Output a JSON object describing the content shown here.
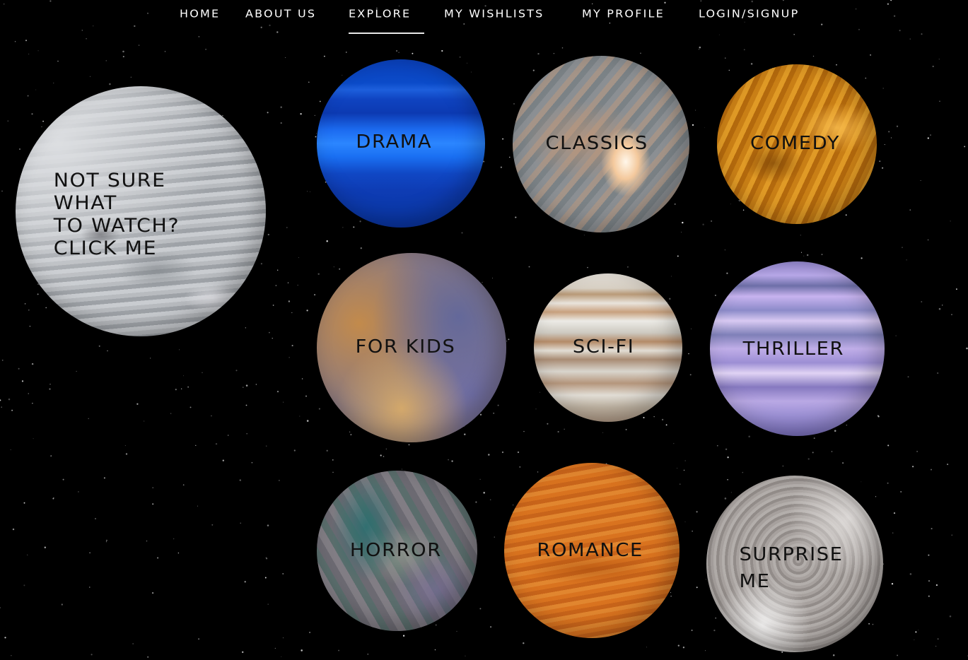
{
  "nav": {
    "items": [
      {
        "label": "HOME",
        "active": false
      },
      {
        "label": "ABOUT US",
        "active": false
      },
      {
        "label": "EXPLORE",
        "active": true
      },
      {
        "label": "MY WISHLISTS",
        "active": false
      },
      {
        "label": "MY PROFILE",
        "active": false
      },
      {
        "label": "LOGIN/SIGNUP",
        "active": false
      }
    ]
  },
  "feature": {
    "label": "NOT SURE\nWHAT\nTO WATCH?\nCLICK ME"
  },
  "genres": [
    {
      "label": "DRAMA"
    },
    {
      "label": "CLASSICS"
    },
    {
      "label": "COMEDY"
    },
    {
      "label": "FOR KIDS"
    },
    {
      "label": "SCI-FI"
    },
    {
      "label": "THRILLER"
    },
    {
      "label": "HORROR"
    },
    {
      "label": "ROMANCE"
    },
    {
      "label": "SURPRISE\nME"
    }
  ],
  "colors": {
    "background": "#000000",
    "nav_text": "#ffffff",
    "label_text": "#111111"
  }
}
